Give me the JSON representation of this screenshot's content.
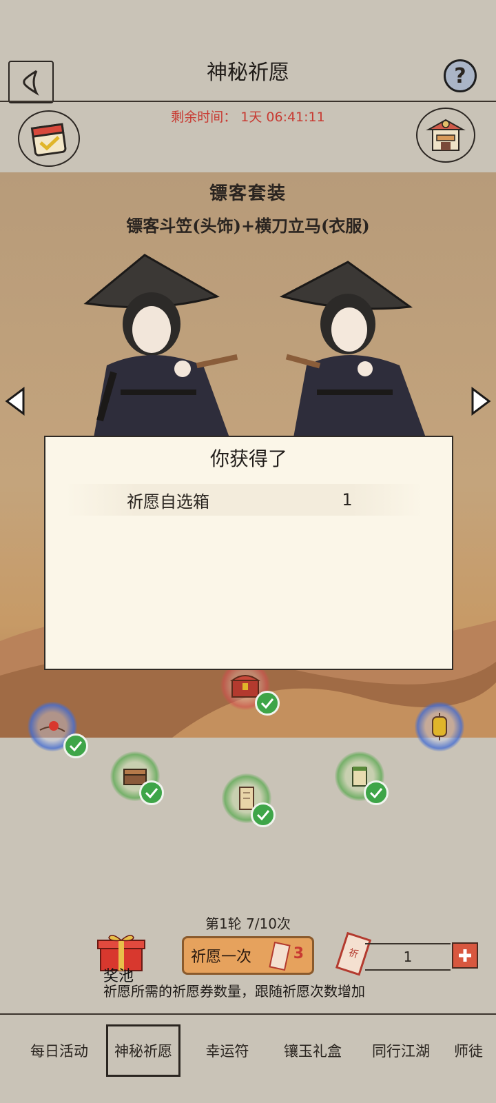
{
  "header": {
    "title": "神秘祈愿",
    "timer_label": "剩余时间：",
    "timer_value": "1天 06:41:11"
  },
  "banner": {
    "set_title": "镖客套装",
    "set_desc": "镖客斗笠(头饰)+横刀立马(衣服)"
  },
  "popup": {
    "title": "你获得了",
    "items": [
      {
        "name": "祈愿自选箱",
        "qty": "1"
      }
    ]
  },
  "slot_icons": [
    "red-ball-icon",
    "chest-icon",
    "scroll-icon",
    "jar-icon",
    "treasure-chest-icon",
    "lantern-icon"
  ],
  "controls": {
    "round_text": "第1轮 7/10次",
    "prize_pool_label": "奖池",
    "wish_button_label": "祈愿一次",
    "wish_cost": "3",
    "ticket_count": "1",
    "hint": "祈愿所需的祈愿券数量，跟随祈愿次数增加"
  },
  "tabs": [
    {
      "label": "每日活动",
      "active": false
    },
    {
      "label": "神秘祈愿",
      "active": true
    },
    {
      "label": "幸运符",
      "active": false
    },
    {
      "label": "镶玉礼盒",
      "active": false
    },
    {
      "label": "同行江湖",
      "active": false
    },
    {
      "label": "师徒",
      "active": false
    }
  ],
  "colors": {
    "background": "#c9c3b7",
    "timer": "#c83a32",
    "popup_bg": "#fbf6e8",
    "wish_button": "#e6a25d",
    "check_green": "#3ea548"
  }
}
